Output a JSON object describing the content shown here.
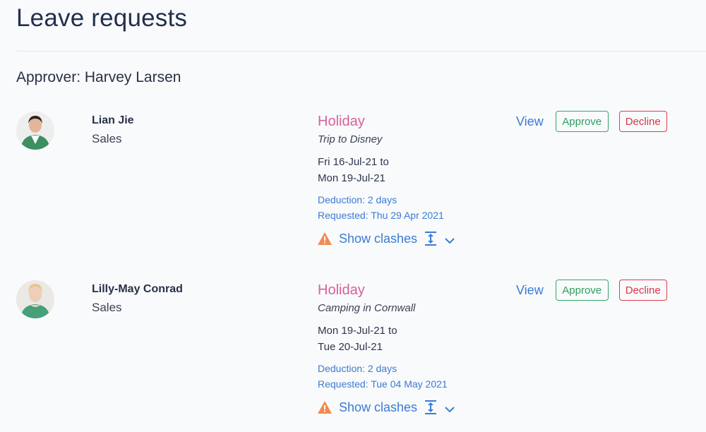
{
  "page": {
    "title": "Leave requests",
    "approver_label": "Approver: Harvey Larsen"
  },
  "colors": {
    "leave_type": "#d9609a",
    "link": "#3a7bd5",
    "approve": "#2e9e5f",
    "decline": "#d83647",
    "warning": "#f28b50"
  },
  "requests": [
    {
      "employee": {
        "name": "Lian Jie",
        "department": "Sales",
        "avatar": "avatar-photo"
      },
      "leave_type": "Holiday",
      "reason": "Trip to Disney",
      "date_from": "Fri 16-Jul-21 to",
      "date_to": "Mon 19-Jul-21",
      "deduction": "Deduction: 2 days",
      "requested": "Requested: Thu 29 Apr 2021",
      "show_clashes_label": "Show clashes",
      "actions": {
        "view": "View",
        "approve": "Approve",
        "decline": "Decline"
      }
    },
    {
      "employee": {
        "name": "Lilly-May Conrad",
        "department": "Sales",
        "avatar": "avatar-photo"
      },
      "leave_type": "Holiday",
      "reason": "Camping in Cornwall",
      "date_from": "Mon 19-Jul-21 to",
      "date_to": "Tue 20-Jul-21",
      "deduction": "Deduction: 2 days",
      "requested": "Requested: Tue 04 May 2021",
      "show_clashes_label": "Show clashes",
      "actions": {
        "view": "View",
        "approve": "Approve",
        "decline": "Decline"
      }
    }
  ]
}
